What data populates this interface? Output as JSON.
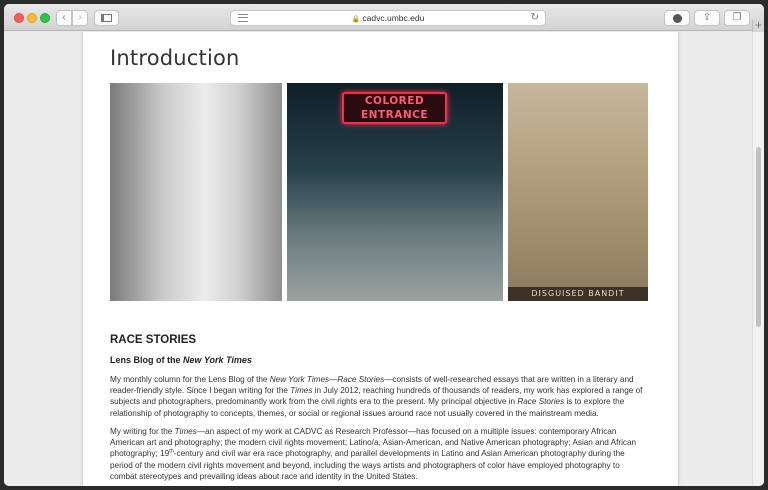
{
  "browser": {
    "url": "cadvc.umbc.edu",
    "icons": [
      "back-icon",
      "forward-icon",
      "sidebar-icon",
      "reader-icon",
      "lock-icon",
      "reload-icon",
      "downloads-icon",
      "share-icon",
      "tabs-icon",
      "new-tab-icon"
    ]
  },
  "page": {
    "title": "Introduction",
    "photos": {
      "sign_line1": "COLORED",
      "sign_line2": "ENTRANCE",
      "caption3": "DISGUISED BANDIT"
    },
    "section_title": "RACE STORIES",
    "subtitle_prefix": "Lens Blog of the ",
    "subtitle_italic": "New York Times",
    "para1": {
      "a": "My monthly column for the Lens Blog of the ",
      "b": "New York Times—Race Stories",
      "c": "—consists of well-researched essays that are written in a literary and reader-friendly style. Since I began writing for the ",
      "d": "Times",
      "e": " in July 2012, reaching hundreds of thousands of readers, my work has explored a range of subjects and photographers, predominantly work from the civil rights era to the present. My principal objective in ",
      "f": "Race Stories",
      "g": " is to explore the relationship of photography to concepts, themes, or social or regional issues around race not usually covered in the mainstream media."
    },
    "para2": {
      "a": "My writing for the ",
      "b": "Times",
      "c": "—an aspect of my work at CADVC as Research Professor—has focused on a multiple issues: contemporary African American art and photography; the modern civil rights movement; Latino/a, Asian-American, and Native American photography; Asian and African photography; 19",
      "d": "th",
      "e": "-century and civil war era race photography, and parallel developments in Latino and Asian American photography during the period of the modern civil rights movement and beyond, including the ways artists and photographers of color have employed photography to combat stereotypes and prevailing ideas about race and identity in the United States."
    }
  }
}
